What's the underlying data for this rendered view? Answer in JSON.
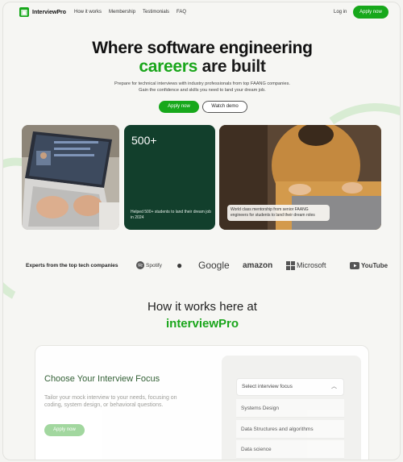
{
  "nav": {
    "logo_text": "InterviewPro",
    "links": [
      "How it works",
      "Membership",
      "Testimonials",
      "FAQ"
    ],
    "login": "Log in",
    "apply": "Apply now"
  },
  "hero": {
    "title_line1": "Where software engineering",
    "title_green": "careers",
    "title_rest": " are built",
    "subtitle_line1": "Prepare for technical interviews with industry professionals from top FAANG companies.",
    "subtitle_line2": "Gain the confidence and skills you need to land your dream job.",
    "apply_button": "Apply now",
    "demo_button": "Watch demo"
  },
  "cards": {
    "stat_number": "500+",
    "stat_text": "Helped 500+ students to land their dream job in 2024",
    "person_caption": "World class mentorship from senior FAANG engineers for students to land their dream roles"
  },
  "brands": {
    "label": "Experts from the top tech companies",
    "names": [
      "Spotify",
      "Apple",
      "Google",
      "amazon",
      "Microsoft",
      "YouTube"
    ]
  },
  "how": {
    "title_line1": "How it works here at",
    "title_line2": "interviewPro"
  },
  "panel": {
    "title": "Choose Your Interview Focus",
    "description": "Tailor your mock interview to your needs, focusing on coding, system design, or behavioral questions.",
    "button": "Apply now",
    "select_placeholder": "Select interview focus",
    "options": [
      "Systems Design",
      "Data Structures and algorithms",
      "Data science"
    ]
  },
  "colors": {
    "brand_green": "#17a81b",
    "dark_card": "#123f2c"
  }
}
